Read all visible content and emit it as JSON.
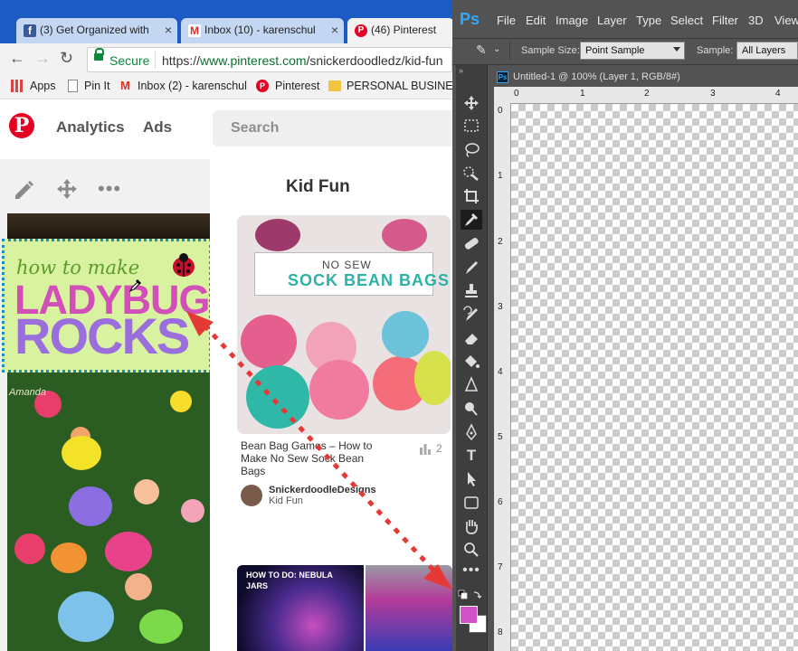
{
  "browser": {
    "tabs": [
      {
        "title": "(3) Get Organized with",
        "favicon_color": "#3b5998"
      },
      {
        "title": "Inbox (10) - karenschul",
        "favicon_color": "#d93025"
      },
      {
        "title": "(46) Pinterest",
        "favicon_color": "#e60023"
      }
    ],
    "secure_label": "Secure",
    "url_scheme": "https://",
    "url_host": "www.pinterest.com",
    "url_path": "/snickerdoodledz/kid-fun",
    "bookmarks": [
      {
        "label": "Apps",
        "icon": "apps-grid-icon"
      },
      {
        "label": "Pin It",
        "icon": "page-icon"
      },
      {
        "label": "Inbox (2) - karenschul",
        "icon": "gmail-icon"
      },
      {
        "label": "Pinterest",
        "icon": "pinterest-icon"
      },
      {
        "label": "PERSONAL BUSINESS",
        "icon": "folder-icon"
      }
    ]
  },
  "pinterest": {
    "logo": "P",
    "nav": {
      "analytics": "Analytics",
      "ads": "Ads"
    },
    "search_placeholder": "Search",
    "board_title": "Kid Fun",
    "left_pin": {
      "line1": "how to make",
      "line2": "LADYBUG",
      "line3": "ROCKS",
      "watermark": "Amanda"
    },
    "pin": {
      "banner_small": "NO SEW",
      "banner_big": "SOCK BEAN BAGS",
      "title": "Bean Bag Games – How to Make No Sew Sock Bean Bags",
      "stats_count": "2",
      "user": "SnickerdoodleDesigns",
      "board": "Kid Fun"
    },
    "next_pin_label": "HOW TO DO: NEBULA JARS"
  },
  "photoshop": {
    "logo": "Ps",
    "menu": [
      "File",
      "Edit",
      "Image",
      "Layer",
      "Type",
      "Select",
      "Filter",
      "3D",
      "View"
    ],
    "options": {
      "sample_size_label": "Sample Size:",
      "sample_size_value": "Point Sample",
      "sample_label": "Sample:",
      "sample_value": "All Layers"
    },
    "document_title": "Untitled-1 @ 100% (Layer 1, RGB/8#)",
    "ruler_top": [
      "0",
      "1",
      "2",
      "3",
      "4"
    ],
    "ruler_left": [
      "0",
      "1",
      "2",
      "3",
      "4",
      "5",
      "6",
      "7",
      "8"
    ],
    "foreground_color": "#d152c8",
    "background_color": "#ffffff",
    "tools": [
      "move-tool-icon",
      "marquee-tool-icon",
      "lasso-tool-icon",
      "quick-select-tool-icon",
      "crop-tool-icon",
      "eyedropper-tool-icon",
      "healing-brush-tool-icon",
      "brush-tool-icon",
      "clone-stamp-tool-icon",
      "history-brush-tool-icon",
      "eraser-tool-icon",
      "paint-bucket-tool-icon",
      "blur-tool-icon",
      "dodge-tool-icon",
      "pen-tool-icon",
      "type-tool-icon",
      "path-select-tool-icon",
      "rectangle-tool-icon",
      "hand-tool-icon",
      "zoom-tool-icon",
      "more-tools-icon"
    ],
    "selected_tool": "eyedropper-tool-icon"
  },
  "annotation": {
    "arrow_color": "#e53935"
  }
}
